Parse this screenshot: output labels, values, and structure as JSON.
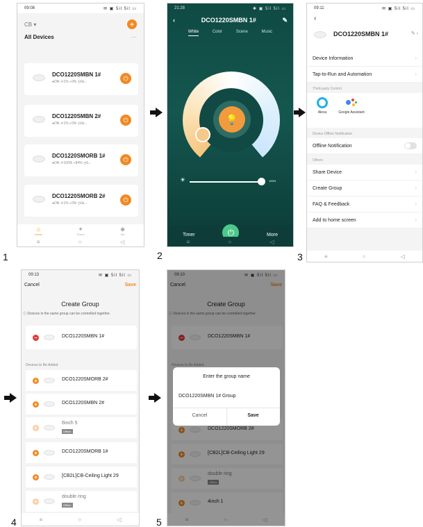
{
  "steps": [
    "1",
    "2",
    "3",
    "4",
    "5"
  ],
  "colors": {
    "accent": "#f08a24",
    "power_green": "#4cc98a",
    "teal_bg": "#14574f",
    "danger": "#e03a3a"
  },
  "nav_keys": {
    "menu": "≡",
    "home": "○",
    "back": "◁"
  },
  "panel1": {
    "time": "09:08",
    "status_icons": "✉ ▣ 5il 5il ▭",
    "home_selector": "CB ▾",
    "all_devices": "All Devices",
    "more": "···",
    "devices": [
      {
        "name": "DCO1220SMBN 1#",
        "meta": "●ON ☀1% ◐0% ◷0s..."
      },
      {
        "name": "DCO1220SMBN 2#",
        "meta": "●ON ☀1% ◐0% ◷0s..."
      },
      {
        "name": "DCO1220SMORB 1#",
        "meta": "●ON ☀100% ◐84% ◷0..."
      },
      {
        "name": "DCO1220SMORB 2#",
        "meta": "●ON ☀1% ◐0% ◷0s..."
      }
    ],
    "tabs": [
      {
        "icon": "⌂",
        "label": "Home"
      },
      {
        "icon": "✦",
        "label": "Scene"
      },
      {
        "icon": "☻",
        "label": "Me"
      }
    ]
  },
  "panel2": {
    "time": "21:28",
    "status_icons": "✱ ▣ 5il 5il ▭",
    "title": "DCO1220SMBN 1#",
    "tabs": [
      "White",
      "Color",
      "Scene",
      "Music"
    ],
    "brightness": "100%",
    "timer": "Timer",
    "more": "More"
  },
  "panel3": {
    "time": "09:11",
    "status_icons": "✉ ▣ 5il 5il ▭",
    "device_name": "DCO1220SMBN 1#",
    "rows_top": [
      "Device Information",
      "Tap-to-Run and Automation"
    ],
    "third_party_label": "Third-party Control",
    "alexa": "Alexa",
    "google": "Google Assistant",
    "offline_section": "Device Offline Notification",
    "offline_notification": "Offline Notification",
    "others_label": "Others",
    "rows_bottom": [
      "Share Device",
      "Create Group",
      "FAQ & Feedback",
      "Add to home screen"
    ]
  },
  "panel4": {
    "time": "09:13",
    "status_icons": "✉ ▣ 5il 5il ▭",
    "cancel": "Cancel",
    "save": "Save",
    "title": "Create Group",
    "hint": "ⓘ Devices in the same group can be controlled together.",
    "selected": "DCO1220SMBN 1#",
    "to_add_label": "Devices to Be Added",
    "offline_tag": "Offline",
    "to_add": [
      {
        "name": "DCO1220SMORB 2#",
        "offline": false
      },
      {
        "name": "DCO1220SMBN 2#",
        "offline": false
      },
      {
        "name": "6inch 5",
        "offline": true
      },
      {
        "name": "DCO1220SMORB 1#",
        "offline": false
      },
      {
        "name": "[CB2L]CB-Ceiling Light 29",
        "offline": false
      },
      {
        "name": "double ring",
        "offline": true
      }
    ]
  },
  "panel5": {
    "time": "09:10",
    "status_icons": "✉ ▣ 5il 5il ▭",
    "cancel": "Cancel",
    "save": "Save",
    "title": "Create Group",
    "hint": "ⓘ Devices in the same group can be controlled together.",
    "selected": "DCO1220SMBN 1#",
    "to_add_label": "Devices to Be Added",
    "offline_tag": "Offline",
    "to_add": [
      {
        "name": "DCO1220SMORB 2#",
        "offline": false
      },
      {
        "name": "[CB2L]CB-Ceiling Light 29",
        "offline": false
      },
      {
        "name": "double ring",
        "offline": true
      },
      {
        "name": "4inch 1",
        "offline": false
      }
    ],
    "dialog": {
      "title": "Enter the group name",
      "value": "DCO1220SMBN 1# Group",
      "cancel": "Cancel",
      "save": "Save"
    }
  }
}
